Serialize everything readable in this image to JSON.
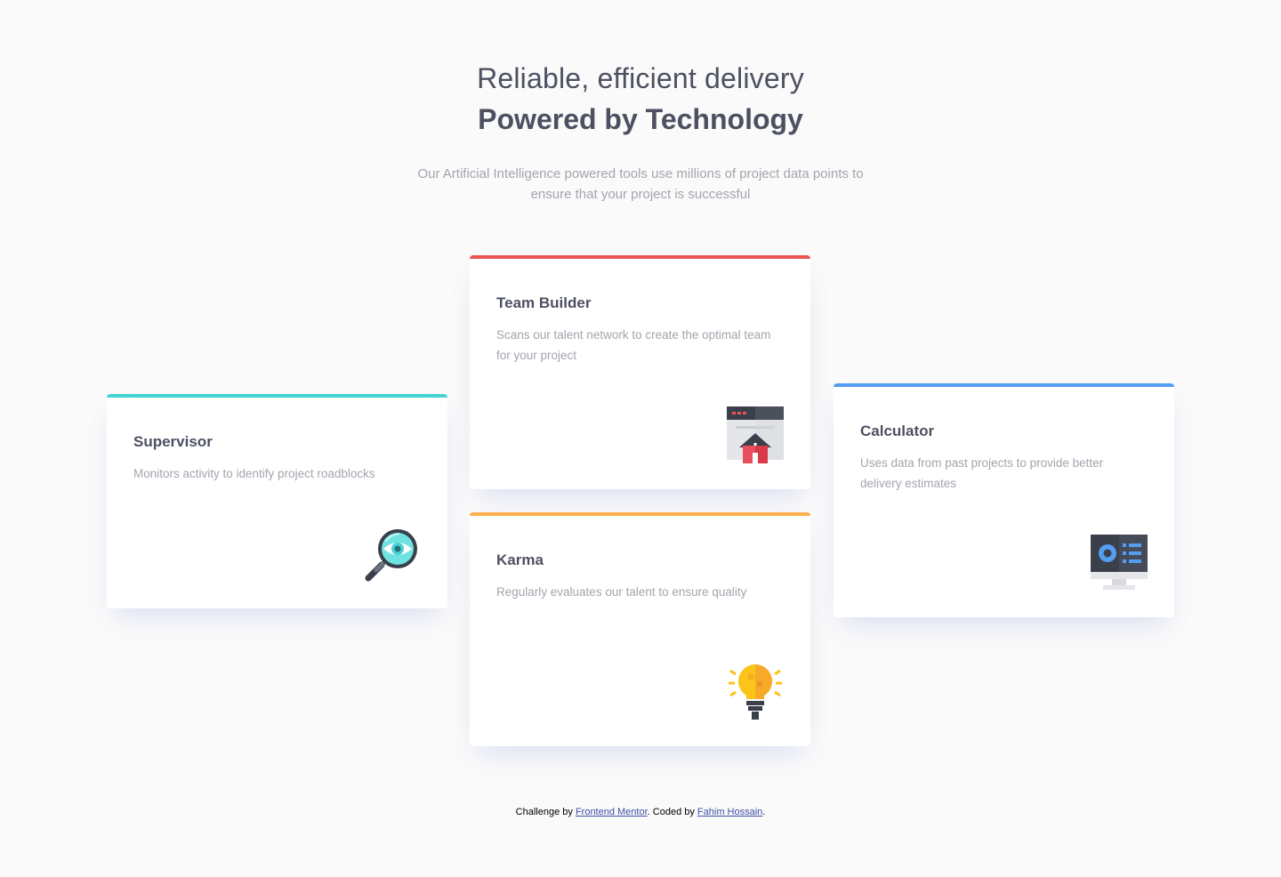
{
  "header": {
    "line1": "Reliable, efficient delivery",
    "line2": "Powered by Technology",
    "description": "Our Artificial Intelligence powered tools use millions of project data points to ensure that your project is successful"
  },
  "cards": {
    "supervisor": {
      "title": "Supervisor",
      "text": "Monitors activity to identify project roadblocks",
      "icon": "magnifier-eye-icon",
      "accent": "#44d3d2"
    },
    "team_builder": {
      "title": "Team Builder",
      "text": "Scans our talent network to create the optimal team for your project",
      "icon": "browser-house-icon",
      "accent": "#ea5454"
    },
    "karma": {
      "title": "Karma",
      "text": "Regularly evaluates our talent to ensure quality",
      "icon": "lightbulb-icon",
      "accent": "#fcaf4a"
    },
    "calculator": {
      "title": "Calculator",
      "text": "Uses data from past projects to provide better delivery estimates",
      "icon": "monitor-icon",
      "accent": "#549ef2"
    }
  },
  "footer": {
    "prefix": "Challenge by ",
    "link1": "Frontend Mentor",
    "middle": ". Coded by ",
    "link2": "Fahim Hossain",
    "suffix": "."
  }
}
